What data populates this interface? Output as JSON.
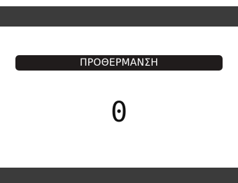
{
  "mode": {
    "label": "ΠΡΟΘΕΡΜΑΝΣΗ"
  },
  "display": {
    "value": "0"
  },
  "colors": {
    "bars": "#3b3b3b",
    "pill": "#201c1c",
    "background": "#ffffff"
  }
}
